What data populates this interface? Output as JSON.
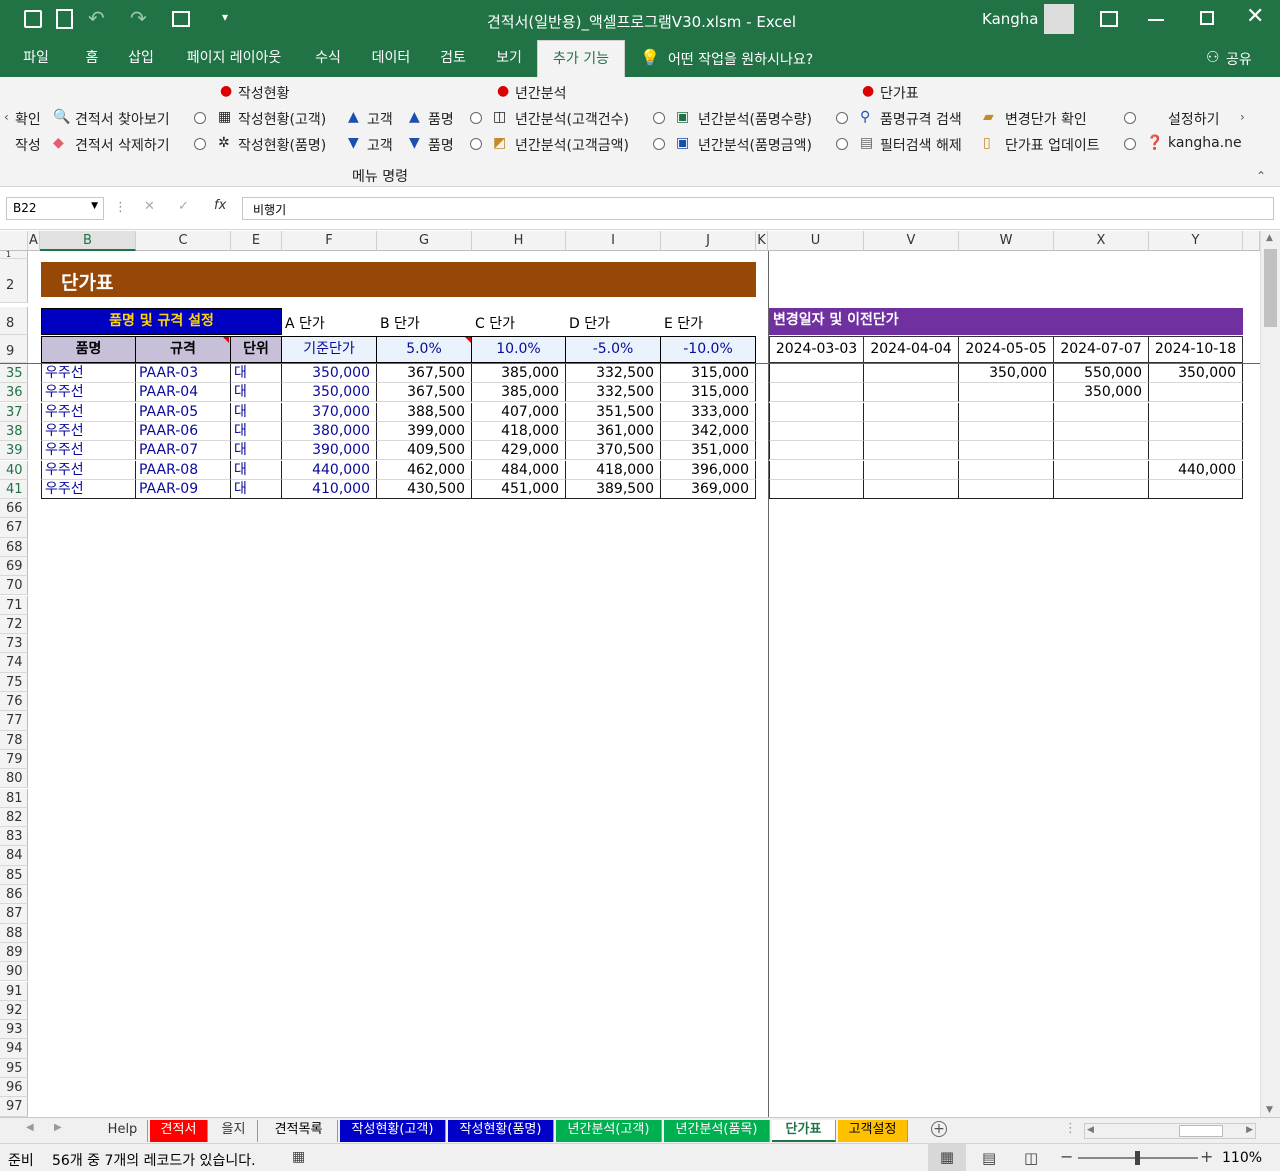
{
  "window": {
    "title": "견적서(일반용)_액셀프로그램V30.xlsm  -  Excel",
    "user": "Kangha"
  },
  "ribbon_tabs": [
    {
      "label": "파일"
    },
    {
      "label": "홈"
    },
    {
      "label": "삽입"
    },
    {
      "label": "페이지 레이아웃"
    },
    {
      "label": "수식"
    },
    {
      "label": "데이터"
    },
    {
      "label": "검토"
    },
    {
      "label": "보기"
    },
    {
      "label": "추가 기능"
    }
  ],
  "tell_me": "어떤 작업을 원하시나요?",
  "share": "공유",
  "ribbon": {
    "group_heads": [
      "작성현황",
      "년간분석",
      "단가표"
    ],
    "left_cut": [
      "확인",
      "작성"
    ],
    "row1": [
      "견적서 찾아보기",
      "작성현황(고객)",
      "고객",
      "품명",
      "년간분석(고객건수)",
      "년간분석(품명수량)",
      "품명규격 검색",
      "변경단가 확인",
      "설정하기"
    ],
    "row2": [
      "견적서 삭제하기",
      "작성현황(품명)",
      "고객",
      "품명",
      "년간분석(고객금액)",
      "년간분석(품명금액)",
      "필터검색 해제",
      "단가표 업데이트",
      "kangha.ne"
    ],
    "group_label": "메뉴 명령"
  },
  "formula_bar": {
    "name_box": "B22",
    "formula": "비행기"
  },
  "columns": [
    "A",
    "B",
    "C",
    "E",
    "F",
    "G",
    "H",
    "I",
    "J",
    "K",
    "U",
    "V",
    "W",
    "X",
    "Y"
  ],
  "sheet": {
    "title": "단가표",
    "setting_header": "품명 및 규격 설정",
    "price_labels": [
      "A 단가",
      "B 단가",
      "C 단가",
      "D 단가",
      "E 단가"
    ],
    "history_header": "변경일자 및 이전단가",
    "col_headers": [
      "품명",
      "규격",
      "단위"
    ],
    "base_label": "기준단가",
    "rates": [
      "5.0%",
      "10.0%",
      "-5.0%",
      "-10.0%"
    ],
    "dates": [
      "2024-03-03",
      "2024-04-04",
      "2024-05-05",
      "2024-07-07",
      "2024-10-18"
    ],
    "rows": [
      {
        "no": "35",
        "name": "우주선",
        "spec": "PAAR-03",
        "unit": "대",
        "prices": [
          "350,000",
          "367,500",
          "385,000",
          "332,500",
          "315,000"
        ],
        "hist": [
          "",
          "",
          "350,000",
          "550,000",
          "350,000"
        ]
      },
      {
        "no": "36",
        "name": "우주선",
        "spec": "PAAR-04",
        "unit": "대",
        "prices": [
          "350,000",
          "367,500",
          "385,000",
          "332,500",
          "315,000"
        ],
        "hist": [
          "",
          "",
          "",
          "350,000",
          ""
        ]
      },
      {
        "no": "37",
        "name": "우주선",
        "spec": "PAAR-05",
        "unit": "대",
        "prices": [
          "370,000",
          "388,500",
          "407,000",
          "351,500",
          "333,000"
        ],
        "hist": [
          "",
          "",
          "",
          "",
          ""
        ]
      },
      {
        "no": "38",
        "name": "우주선",
        "spec": "PAAR-06",
        "unit": "대",
        "prices": [
          "380,000",
          "399,000",
          "418,000",
          "361,000",
          "342,000"
        ],
        "hist": [
          "",
          "",
          "",
          "",
          ""
        ]
      },
      {
        "no": "39",
        "name": "우주선",
        "spec": "PAAR-07",
        "unit": "대",
        "prices": [
          "390,000",
          "409,500",
          "429,000",
          "370,500",
          "351,000"
        ],
        "hist": [
          "",
          "",
          "",
          "",
          ""
        ]
      },
      {
        "no": "40",
        "name": "우주선",
        "spec": "PAAR-08",
        "unit": "대",
        "prices": [
          "440,000",
          "462,000",
          "484,000",
          "418,000",
          "396,000"
        ],
        "hist": [
          "",
          "",
          "",
          "",
          "440,000"
        ]
      },
      {
        "no": "41",
        "name": "우주선",
        "spec": "PAAR-09",
        "unit": "대",
        "prices": [
          "410,000",
          "430,500",
          "451,000",
          "389,500",
          "369,000"
        ],
        "hist": [
          "",
          "",
          "",
          "",
          ""
        ]
      }
    ],
    "top_row_nums": [
      "1",
      "2",
      "8",
      "9"
    ],
    "empty_rows": [
      "66",
      "67",
      "68",
      "69",
      "70",
      "71",
      "72",
      "73",
      "74",
      "75",
      "76",
      "77",
      "78",
      "79",
      "80",
      "81",
      "82",
      "83",
      "84",
      "85",
      "86",
      "87",
      "88",
      "89",
      "90",
      "91",
      "92",
      "93",
      "94",
      "95",
      "96",
      "97"
    ]
  },
  "sheet_tabs": [
    {
      "label": "Help",
      "bg": "#f0f0f0",
      "fg": "#333"
    },
    {
      "label": "견적서",
      "bg": "#ff0000",
      "fg": "#ffffff"
    },
    {
      "label": "을지",
      "bg": "#f0f0f0",
      "fg": "#333"
    },
    {
      "label": "견적목록",
      "bg": "#f0f0f0",
      "fg": "#000"
    },
    {
      "label": "작성현황(고객)",
      "bg": "#0000c8",
      "fg": "#ffffff"
    },
    {
      "label": "작성현황(품명)",
      "bg": "#0000c8",
      "fg": "#ffffff"
    },
    {
      "label": "년간분석(고객)",
      "bg": "#00b050",
      "fg": "#ffffff"
    },
    {
      "label": "년간분석(품목)",
      "bg": "#00b050",
      "fg": "#ffffff"
    },
    {
      "label": "단가표",
      "bg": "#ffffff",
      "fg": "#217346"
    },
    {
      "label": "고객설정",
      "bg": "#ffc000",
      "fg": "#000000"
    }
  ],
  "status": {
    "mode": "준비",
    "message": "56개 중 7개의 레코드가 있습니다.",
    "zoom": "110%"
  },
  "colors": {
    "excel_green": "#217346",
    "title_brown": "#974706",
    "setting_blue": "#0000c0",
    "hist_purple": "#7030a0"
  }
}
